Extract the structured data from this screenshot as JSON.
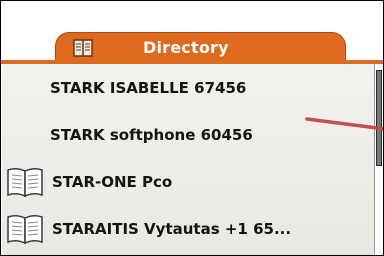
{
  "tab": {
    "label": "Directory",
    "icon": "phonebook-icon"
  },
  "entries": [
    {
      "name": "STARK ISABELLE 67456",
      "icon": null
    },
    {
      "name": "STARK softphone 60456",
      "icon": null
    },
    {
      "name": "STAR-ONE Pco",
      "icon": "book-icon"
    },
    {
      "name": "STARAITIS Vytautas +1 65...",
      "icon": "book-icon"
    }
  ],
  "colors": {
    "accent": "#de6a1e",
    "pointer": "#c0504d"
  }
}
